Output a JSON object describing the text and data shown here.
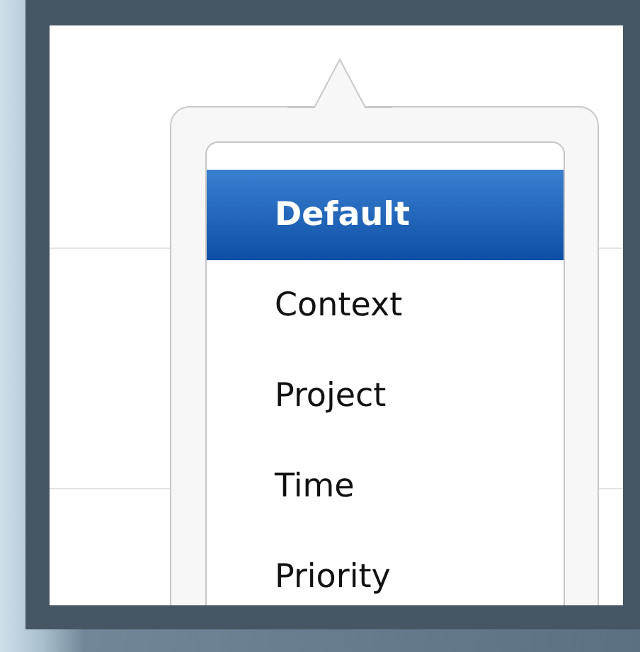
{
  "menu": {
    "items": [
      {
        "label": "Default",
        "selected": true
      },
      {
        "label": "Context",
        "selected": false
      },
      {
        "label": "Project",
        "selected": false
      },
      {
        "label": "Time",
        "selected": false
      },
      {
        "label": "Priority",
        "selected": false
      }
    ]
  }
}
